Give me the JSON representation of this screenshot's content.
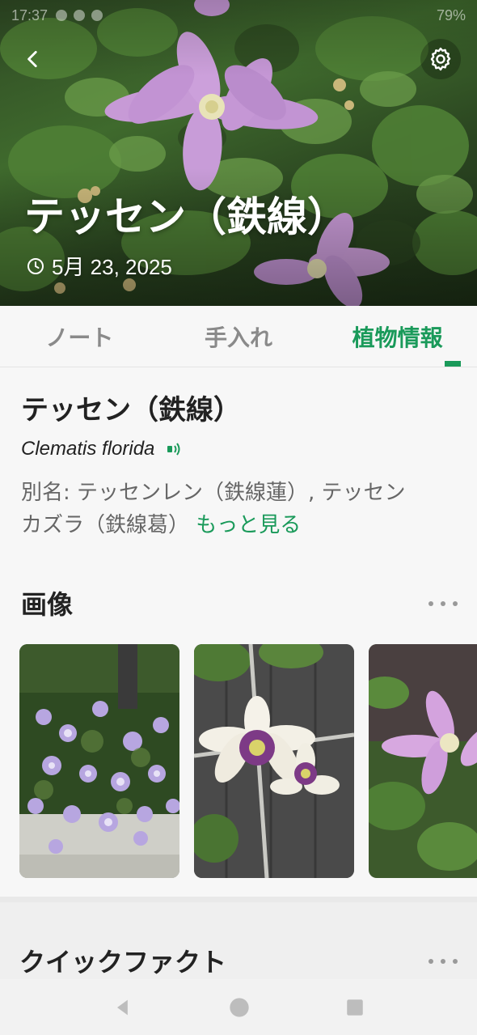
{
  "status": {
    "time": "17:37",
    "battery": "79%"
  },
  "header": {
    "title": "テッセン（鉄線）",
    "date": "5月 23, 2025"
  },
  "tabs": [
    {
      "label": "ノート",
      "active": false
    },
    {
      "label": "手入れ",
      "active": false
    },
    {
      "label": "植物情報",
      "active": true
    }
  ],
  "plant": {
    "name": "テッセン（鉄線）",
    "scientific_name": "Clematis florida",
    "alias_line1": "別名: テッセンレン（鉄線蓮）, テッセン",
    "alias_line2": "カズラ（鉄線葛）",
    "more_label": "もっと見る"
  },
  "images_section": {
    "title": "画像",
    "images": [
      {
        "name": "image-purple-clematis-bush"
      },
      {
        "name": "image-white-clematis-flower"
      },
      {
        "name": "image-pink-clematis-flower"
      }
    ]
  },
  "quick_facts": {
    "title": "クイックファクト"
  },
  "colors": {
    "accent": "#1a9a5a",
    "text": "#222222",
    "muted": "#8a8a8a",
    "background": "#f7f7f7"
  },
  "icons": [
    "back-arrow-icon",
    "gear-icon",
    "clock-icon",
    "speaker-icon",
    "more-dots-icon",
    "nav-back-icon",
    "nav-home-icon",
    "nav-recents-icon"
  ]
}
